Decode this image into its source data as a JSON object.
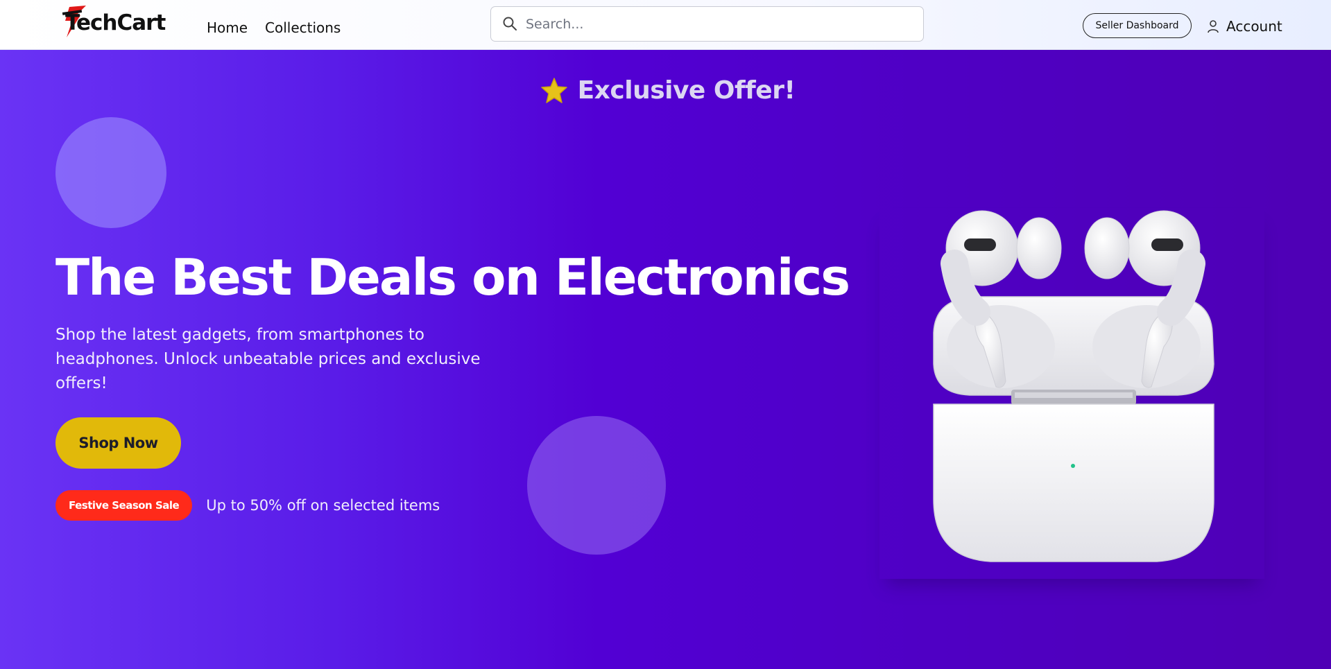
{
  "header": {
    "logo": "TechCart",
    "nav": [
      {
        "label": "Home"
      },
      {
        "label": "Collections"
      }
    ],
    "search": {
      "placeholder": "Search...",
      "value": ""
    },
    "seller_dashboard_label": "Seller Dashboard",
    "account_label": "Account"
  },
  "hero": {
    "offer_badge": "Exclusive Offer!",
    "title": "The Best Deals on Electronics",
    "description": "Shop the latest gadgets, from smartphones to headphones. Unlock unbeatable prices and exclusive offers!",
    "cta_label": "Shop Now",
    "sale_badge": "Festive Season Sale",
    "sale_text": "Up to 50% off on selected items"
  },
  "icons": {
    "search": "search-icon",
    "account": "user-icon",
    "offer": "star-icon"
  },
  "colors": {
    "hero_gradient_start": "#6a33f5",
    "hero_gradient_end": "#4f00b5",
    "cta": "#e1b90a",
    "sale_badge": "#ff2a1a",
    "star": "#e6c21a"
  }
}
